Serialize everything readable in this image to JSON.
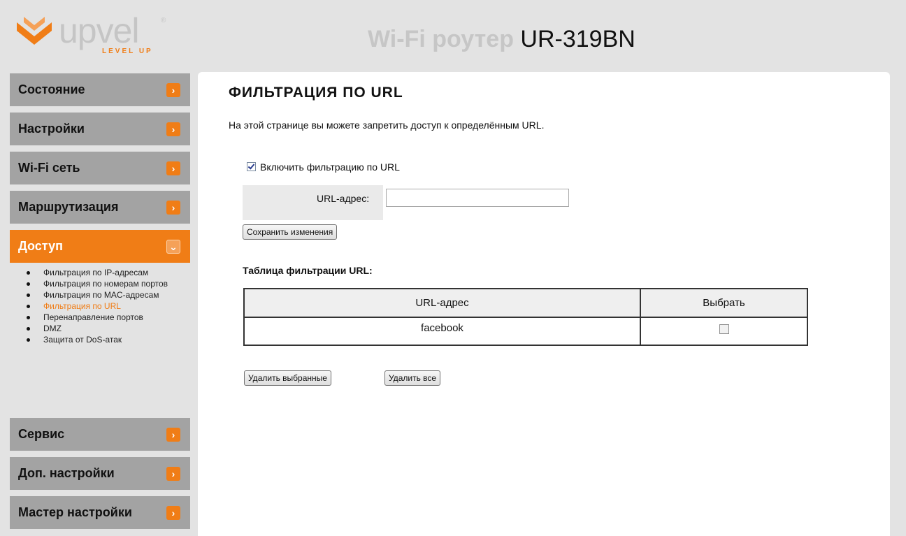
{
  "header": {
    "logo_word": "upvel",
    "logo_tag": "LEVEL UP",
    "logo_reg": "®",
    "title_prefix": "Wi-Fi роутер",
    "title_model": "UR-319BN"
  },
  "sidebar": {
    "items": [
      {
        "label": "Состояние",
        "arrow": "›"
      },
      {
        "label": "Настройки",
        "arrow": "›"
      },
      {
        "label": "Wi-Fi сеть",
        "arrow": "›"
      },
      {
        "label": "Маршрутизация",
        "arrow": "›"
      },
      {
        "label": "Доступ",
        "arrow": "⌄"
      },
      {
        "label": "Сервис",
        "arrow": "›"
      },
      {
        "label": "Доп. настройки",
        "arrow": "›"
      },
      {
        "label": "Мастер настройки",
        "arrow": "›"
      }
    ],
    "submenu": [
      {
        "label": "Фильтрация по IP-адресам"
      },
      {
        "label": "Фильтрация по номерам портов"
      },
      {
        "label": "Фильтрация по MAC-адресам"
      },
      {
        "label": "Фильтрация по URL"
      },
      {
        "label": "Перенаправление портов"
      },
      {
        "label": "DMZ"
      },
      {
        "label": "Защита от DoS-атак"
      }
    ]
  },
  "main": {
    "title": "ФИЛЬТРАЦИЯ ПО URL",
    "description": "На этой странице вы можете запретить доступ к определённым URL.",
    "enable_label": "Включить фильтрацию по URL",
    "url_label": "URL-адрес:",
    "url_value": "",
    "save_button": "Сохранить изменения",
    "table_title": "Таблица фильтрации URL:",
    "table": {
      "headers": [
        "URL-адрес",
        "Выбрать"
      ],
      "rows": [
        {
          "url": "facebook",
          "selected": false
        }
      ]
    },
    "delete_selected_button": "Удалить выбранные",
    "delete_all_button": "Удалить все"
  },
  "colors": {
    "accent": "#f07d16",
    "nav_bg": "#a3a3a3",
    "page_bg": "#e3e3e3"
  }
}
